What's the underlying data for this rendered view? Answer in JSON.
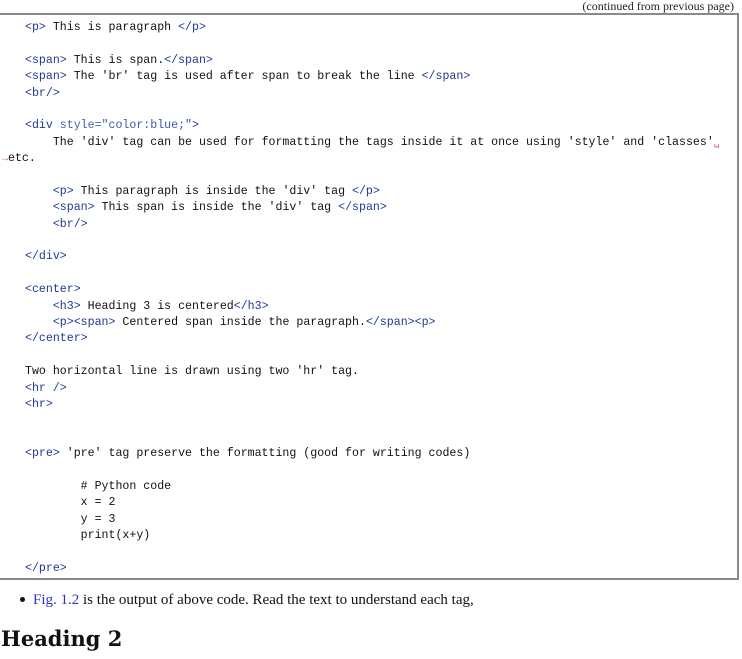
{
  "header": {
    "continued_note": "(continued from previous page)"
  },
  "code_listing": {
    "lines": [
      {
        "indent": 0,
        "parts": [
          [
            "tag",
            "<p>"
          ],
          [
            "txt",
            " This is paragraph "
          ],
          [
            "tag",
            "</p>"
          ]
        ]
      },
      {
        "indent": 0,
        "parts": []
      },
      {
        "indent": 0,
        "parts": [
          [
            "tag",
            "<span>"
          ],
          [
            "txt",
            " This is span."
          ],
          [
            "tag",
            "</span>"
          ]
        ]
      },
      {
        "indent": 0,
        "parts": [
          [
            "tag",
            "<span>"
          ],
          [
            "txt",
            " The 'br' tag is used after span to break the line "
          ],
          [
            "tag",
            "</span>"
          ]
        ]
      },
      {
        "indent": 0,
        "parts": [
          [
            "tag",
            "<br/>"
          ]
        ]
      },
      {
        "indent": 0,
        "parts": []
      },
      {
        "indent": 0,
        "parts": [
          [
            "tag",
            "<div "
          ],
          [
            "attr",
            "style="
          ],
          [
            "str",
            "\"color:blue;\""
          ],
          [
            "tag",
            ">"
          ]
        ]
      },
      {
        "indent": 4,
        "parts": [
          [
            "txt",
            "The 'div' tag can be used for formatting the tags inside it at once using 'style' and 'classes'"
          ],
          [
            "wrap",
            "␣"
          ]
        ]
      },
      {
        "indent": -1,
        "parts": [
          [
            "wrap",
            "→"
          ],
          [
            "txt",
            "etc."
          ]
        ]
      },
      {
        "indent": 0,
        "parts": []
      },
      {
        "indent": 4,
        "parts": [
          [
            "tag",
            "<p>"
          ],
          [
            "txt",
            " This paragraph is inside the 'div' tag "
          ],
          [
            "tag",
            "</p>"
          ]
        ]
      },
      {
        "indent": 4,
        "parts": [
          [
            "tag",
            "<span>"
          ],
          [
            "txt",
            " This span is inside the 'div' tag "
          ],
          [
            "tag",
            "</span>"
          ]
        ]
      },
      {
        "indent": 4,
        "parts": [
          [
            "tag",
            "<br/>"
          ]
        ]
      },
      {
        "indent": 0,
        "parts": []
      },
      {
        "indent": 0,
        "parts": [
          [
            "tag",
            "</div>"
          ]
        ]
      },
      {
        "indent": 0,
        "parts": []
      },
      {
        "indent": 0,
        "parts": [
          [
            "tag",
            "<center>"
          ]
        ]
      },
      {
        "indent": 4,
        "parts": [
          [
            "tag",
            "<h3>"
          ],
          [
            "txt",
            " Heading 3 is centered"
          ],
          [
            "tag",
            "</h3>"
          ]
        ]
      },
      {
        "indent": 4,
        "parts": [
          [
            "tag",
            "<p><span>"
          ],
          [
            "txt",
            " Centered span inside the paragraph."
          ],
          [
            "tag",
            "</span><p>"
          ]
        ]
      },
      {
        "indent": 0,
        "parts": [
          [
            "tag",
            "</center>"
          ]
        ]
      },
      {
        "indent": 0,
        "parts": []
      },
      {
        "indent": 0,
        "parts": [
          [
            "txt",
            "Two horizontal line is drawn using two 'hr' tag."
          ]
        ]
      },
      {
        "indent": 0,
        "parts": [
          [
            "tag",
            "<hr />"
          ]
        ]
      },
      {
        "indent": 0,
        "parts": [
          [
            "tag",
            "<hr>"
          ]
        ]
      },
      {
        "indent": 0,
        "parts": []
      },
      {
        "indent": 0,
        "parts": []
      },
      {
        "indent": 0,
        "parts": [
          [
            "tag",
            "<pre>"
          ],
          [
            "txt",
            " 'pre' tag preserve the formatting (good for writing codes)"
          ]
        ]
      },
      {
        "indent": 0,
        "parts": []
      },
      {
        "indent": 8,
        "parts": [
          [
            "txt",
            "# Python code"
          ]
        ]
      },
      {
        "indent": 8,
        "parts": [
          [
            "txt",
            "x = 2"
          ]
        ]
      },
      {
        "indent": 8,
        "parts": [
          [
            "txt",
            "y = 3"
          ]
        ]
      },
      {
        "indent": 8,
        "parts": [
          [
            "txt",
            "print(x+y)"
          ]
        ]
      },
      {
        "indent": 0,
        "parts": []
      },
      {
        "indent": 0,
        "parts": [
          [
            "tag",
            "</pre>"
          ]
        ]
      }
    ]
  },
  "bullet": {
    "link_text": "Fig. 1.2",
    "rest_text": " is the output of above code. Read the text to understand each tag,"
  },
  "heading": {
    "text": "Heading 2"
  },
  "colors": {
    "tag": "#1f3a93",
    "wrap_marker": "#d9534f",
    "link": "#2b33c9",
    "border": "#8a8a8a"
  }
}
